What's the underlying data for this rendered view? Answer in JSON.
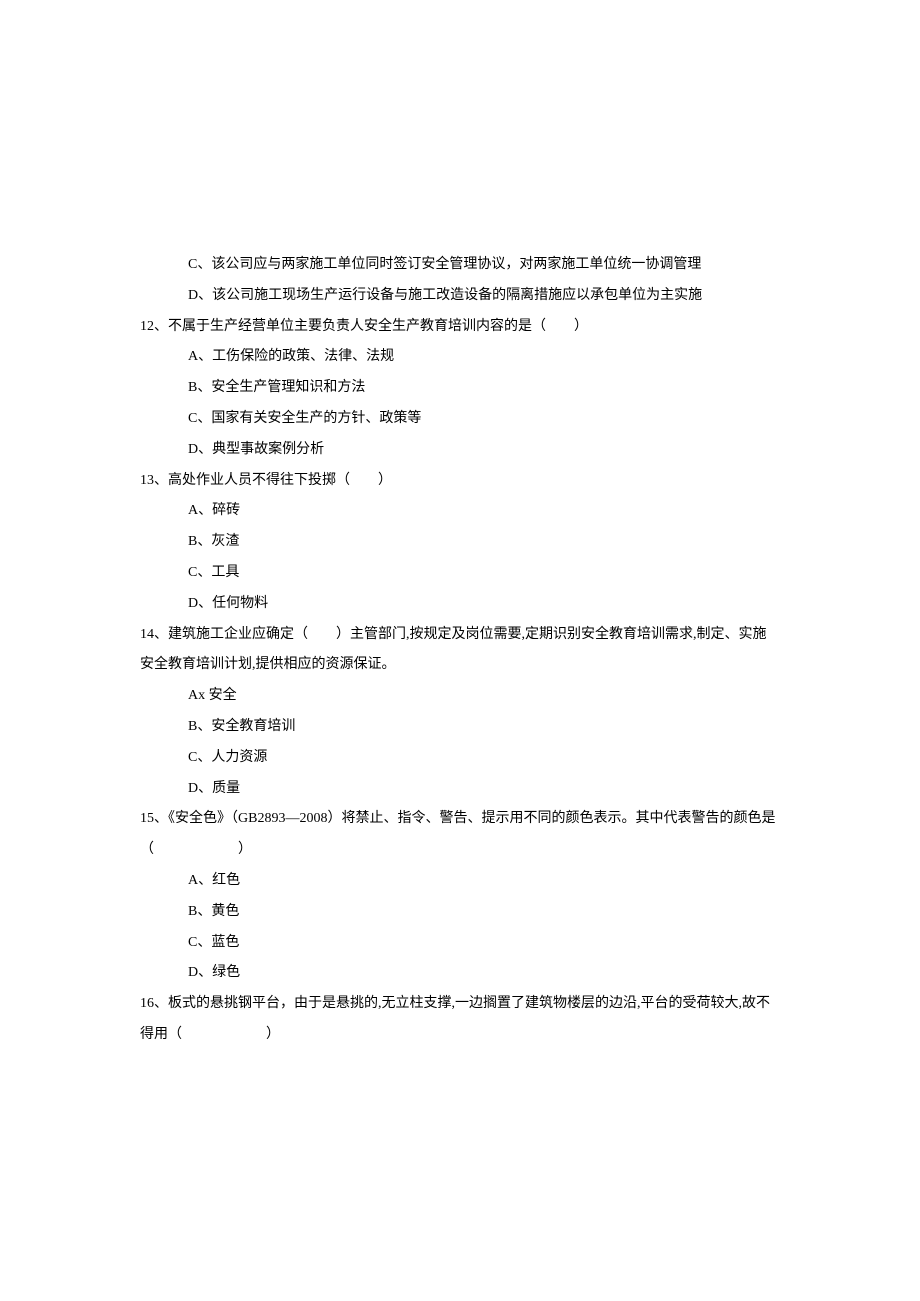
{
  "lines": {
    "q11_C": "C、该公司应与两家施工单位同时签订安全管理协议，对两家施工单位统一协调管理",
    "q11_D": "D、该公司施工现场生产运行设备与施工改造设备的隔离措施应以承包单位为主实施",
    "q12_stem": "12、不属于生产经营单位主要负责人安全生产教育培训内容的是（　　）",
    "q12_A": "A、工伤保险的政策、法律、法规",
    "q12_B": "B、安全生产管理知识和方法",
    "q12_C": "C、国家有关安全生产的方针、政策等",
    "q12_D": "D、典型事故案例分析",
    "q13_stem": "13、高处作业人员不得往下投掷（　　）",
    "q13_A": "A、碎砖",
    "q13_B": "B、灰渣",
    "q13_C": "C、工具",
    "q13_D": "D、任何物料",
    "q14_stem": "14、建筑施工企业应确定（　　）主管部门,按规定及岗位需要,定期识别安全教育培训需求,制定、实施安全教育培训计划,提供相应的资源保证。",
    "q14_A": "Ax 安全",
    "q14_B": "B、安全教育培训",
    "q14_C": "C、人力资源",
    "q14_D": "D、质量",
    "q15_stem": "15、《安全色》（GB2893—2008）将禁止、指令、警告、提示用不同的颜色表示。其中代表警告的颜色是（　　　　　　）",
    "q15_A": "A、红色",
    "q15_B": "B、黄色",
    "q15_C": "C、蓝色",
    "q15_D": "D、绿色",
    "q16_stem": "16、板式的悬挑钢平台，由于是悬挑的,无立柱支撑,一边搁置了建筑物楼层的边沿,平台的受荷较大,故不得用（　　　　　　）"
  }
}
